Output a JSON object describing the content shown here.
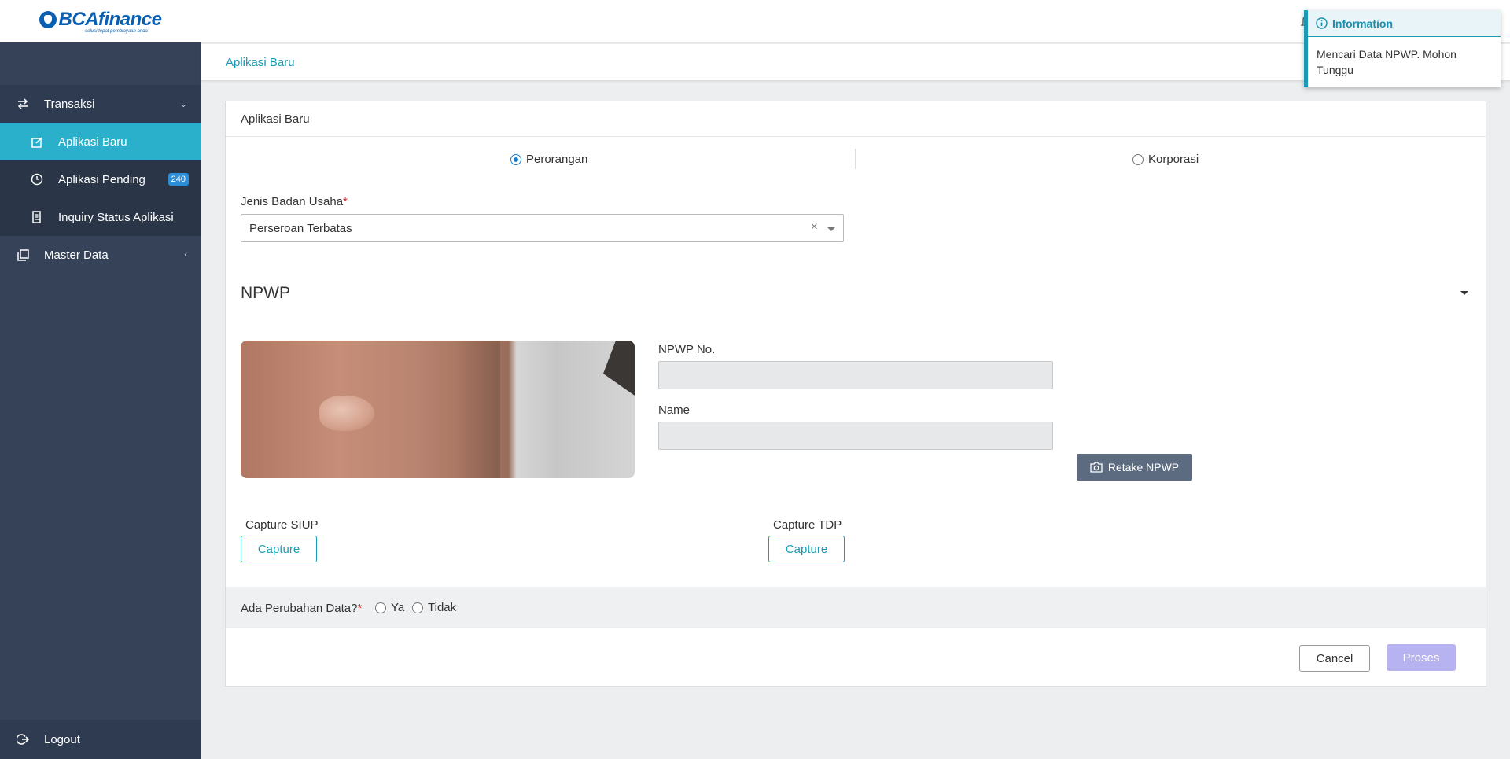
{
  "brand": {
    "name_a": "BCA",
    "name_b": "finance",
    "tagline": "solusi tepat pembiayaan anda"
  },
  "sidebar": {
    "groups": [
      {
        "label": "Transaksi",
        "icon": "swap-icon"
      },
      {
        "label": "Master Data",
        "icon": "copy-icon"
      }
    ],
    "items": [
      {
        "label": "Aplikasi Baru",
        "icon": "edit-icon"
      },
      {
        "label": "Aplikasi Pending",
        "icon": "clock-icon",
        "badge": "240"
      },
      {
        "label": "Inquiry Status Aplikasi",
        "icon": "list-icon"
      }
    ],
    "logout": "Logout"
  },
  "breadcrumb": "Aplikasi Baru",
  "card": {
    "title": "Aplikasi Baru",
    "type_options": [
      "Perorangan",
      "Korporasi"
    ],
    "selected_type": "Perorangan",
    "jenis_label": "Jenis Badan Usaha",
    "jenis_value": "Perseroan Terbatas",
    "clear_symbol": "×",
    "npwp_title": "NPWP",
    "npwp_no_label": "NPWP No.",
    "name_label": "Name",
    "retake_label": "Retake NPWP",
    "siup_label": "Capture SIUP",
    "tdp_label": "Capture TDP",
    "capture_label": "Capture",
    "question_label": "Ada Perubahan Data?",
    "required_mark": "*",
    "answer_yes": "Ya",
    "answer_no": "Tidak",
    "cancel_label": "Cancel",
    "proses_label": "Proses"
  },
  "toast": {
    "title": "Information",
    "message": "Mencari Data NPWP. Mohon Tunggu"
  },
  "colors": {
    "sidebar": "#354258",
    "accent": "#2bb0cc",
    "link": "#1a9bb4",
    "proses_disabled": "#b7b2f0"
  }
}
